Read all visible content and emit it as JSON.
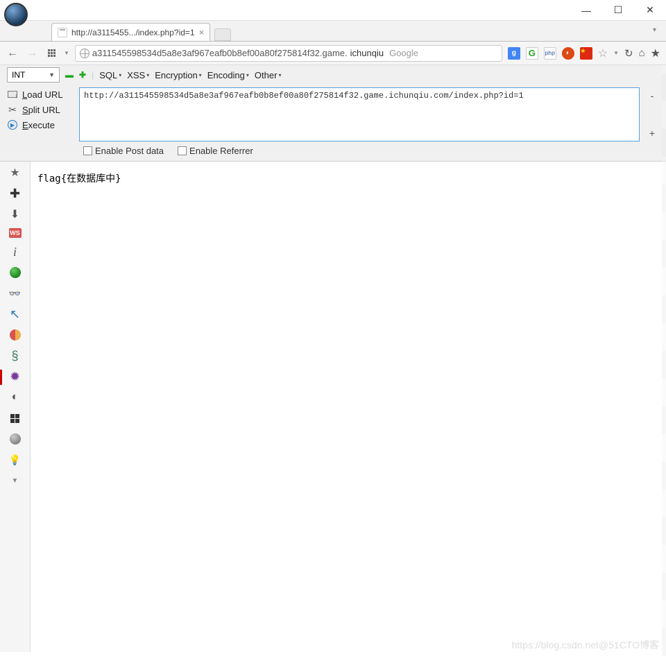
{
  "window": {
    "minimize": "—",
    "maximize": "☐",
    "close": "✕"
  },
  "tab": {
    "title": "http://a3115455.../index.php?id=1"
  },
  "address": {
    "url_prefix": "a311545598534d5a8e3af967eafb0b8ef00a80f275814f32.game.",
    "url_highlight": "ichunqiu",
    "search_engine": "Google"
  },
  "ext_badges": {
    "g": "g",
    "c": "G",
    "php": "php",
    "u": "◐"
  },
  "hackbar": {
    "int_select": "INT",
    "menu": {
      "sql": "SQL",
      "xss": "XSS",
      "encryption": "Encryption",
      "encoding": "Encoding",
      "other": "Other"
    },
    "actions": {
      "load": "oad URL",
      "load_u": "L",
      "split": "plit URL",
      "split_u": "S",
      "execute": "xecute",
      "execute_u": "E"
    },
    "url_value": "http://a311545598534d5a8e3af967eafb0b8ef00a80f275814f32.game.ichunqiu.com/index.php?id=1",
    "enable_post": "Enable Post data",
    "enable_referrer": "Enable Referrer"
  },
  "page_content": "flag{在数据库中}",
  "watermark": "https://blog.csdn.net@51CTO博客"
}
